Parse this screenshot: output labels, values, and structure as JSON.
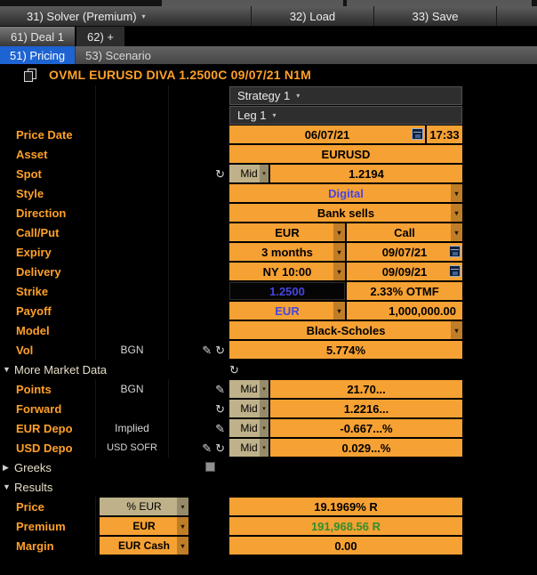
{
  "colors": {
    "amber": "#F6A133",
    "label": "#FFA028",
    "blue": "#4646DF",
    "green": "#2F8F2F",
    "tabblue": "#1E63D2",
    "muted": "#BFB28A"
  },
  "icons": {
    "caret_down": "▾",
    "refresh": "↻",
    "pencil": "✎",
    "expanded": "▼",
    "collapsed": "▶"
  },
  "toolbar": {
    "solver": "31) Solver (Premium)",
    "load": "32) Load",
    "save": "33) Save"
  },
  "deal_tabs": {
    "deal1": "61) Deal 1",
    "add": "62) +"
  },
  "view_tabs": {
    "pricing": "51) Pricing",
    "scenario": "53) Scenario"
  },
  "title": "OVML EURUSD DIVA 1.2500C 09/07/21 N1M",
  "header": {
    "strategy": "Strategy 1",
    "leg": "Leg 1"
  },
  "sections": {
    "more_market_data": "More Market Data",
    "greeks": "Greeks",
    "results": "Results"
  },
  "fields": {
    "price_date": {
      "label": "Price Date",
      "date": "06/07/21",
      "time": "17:33"
    },
    "asset": {
      "label": "Asset",
      "value": "EURUSD"
    },
    "spot": {
      "label": "Spot",
      "side": "Mid",
      "value": "1.2194"
    },
    "style": {
      "label": "Style",
      "value": "Digital"
    },
    "direction": {
      "label": "Direction",
      "value": "Bank sells"
    },
    "call_put": {
      "label": "Call/Put",
      "ccy": "EUR",
      "option_type": "Call"
    },
    "expiry": {
      "label": "Expiry",
      "tenor": "3 months",
      "date": "09/07/21"
    },
    "delivery": {
      "label": "Delivery",
      "cut": "NY 10:00",
      "date": "09/09/21"
    },
    "strike": {
      "label": "Strike",
      "value": "1.2500",
      "moneyness": "2.33% OTMF"
    },
    "payoff": {
      "label": "Payoff",
      "ccy": "EUR",
      "amount": "1,000,000.00"
    },
    "model": {
      "label": "Model",
      "value": "Black-Scholes"
    },
    "vol": {
      "label": "Vol",
      "source": "BGN",
      "value": "5.774%"
    },
    "points": {
      "label": "Points",
      "source": "BGN",
      "side": "Mid",
      "value": "21.70..."
    },
    "forward": {
      "label": "Forward",
      "side": "Mid",
      "value": "1.2216..."
    },
    "eur_depo": {
      "label": "EUR Depo",
      "source": "Implied",
      "side": "Mid",
      "value": "-0.667...%"
    },
    "usd_depo": {
      "label": "USD Depo",
      "source": "USD SOFR",
      "side": "Mid",
      "value": "0.029...%"
    },
    "price": {
      "label": "Price",
      "unit": "% EUR",
      "value": "19.1969% R"
    },
    "premium": {
      "label": "Premium",
      "unit": "EUR",
      "value": "191,968.56 R"
    },
    "margin": {
      "label": "Margin",
      "unit": "EUR Cash",
      "value": "0.00"
    }
  }
}
